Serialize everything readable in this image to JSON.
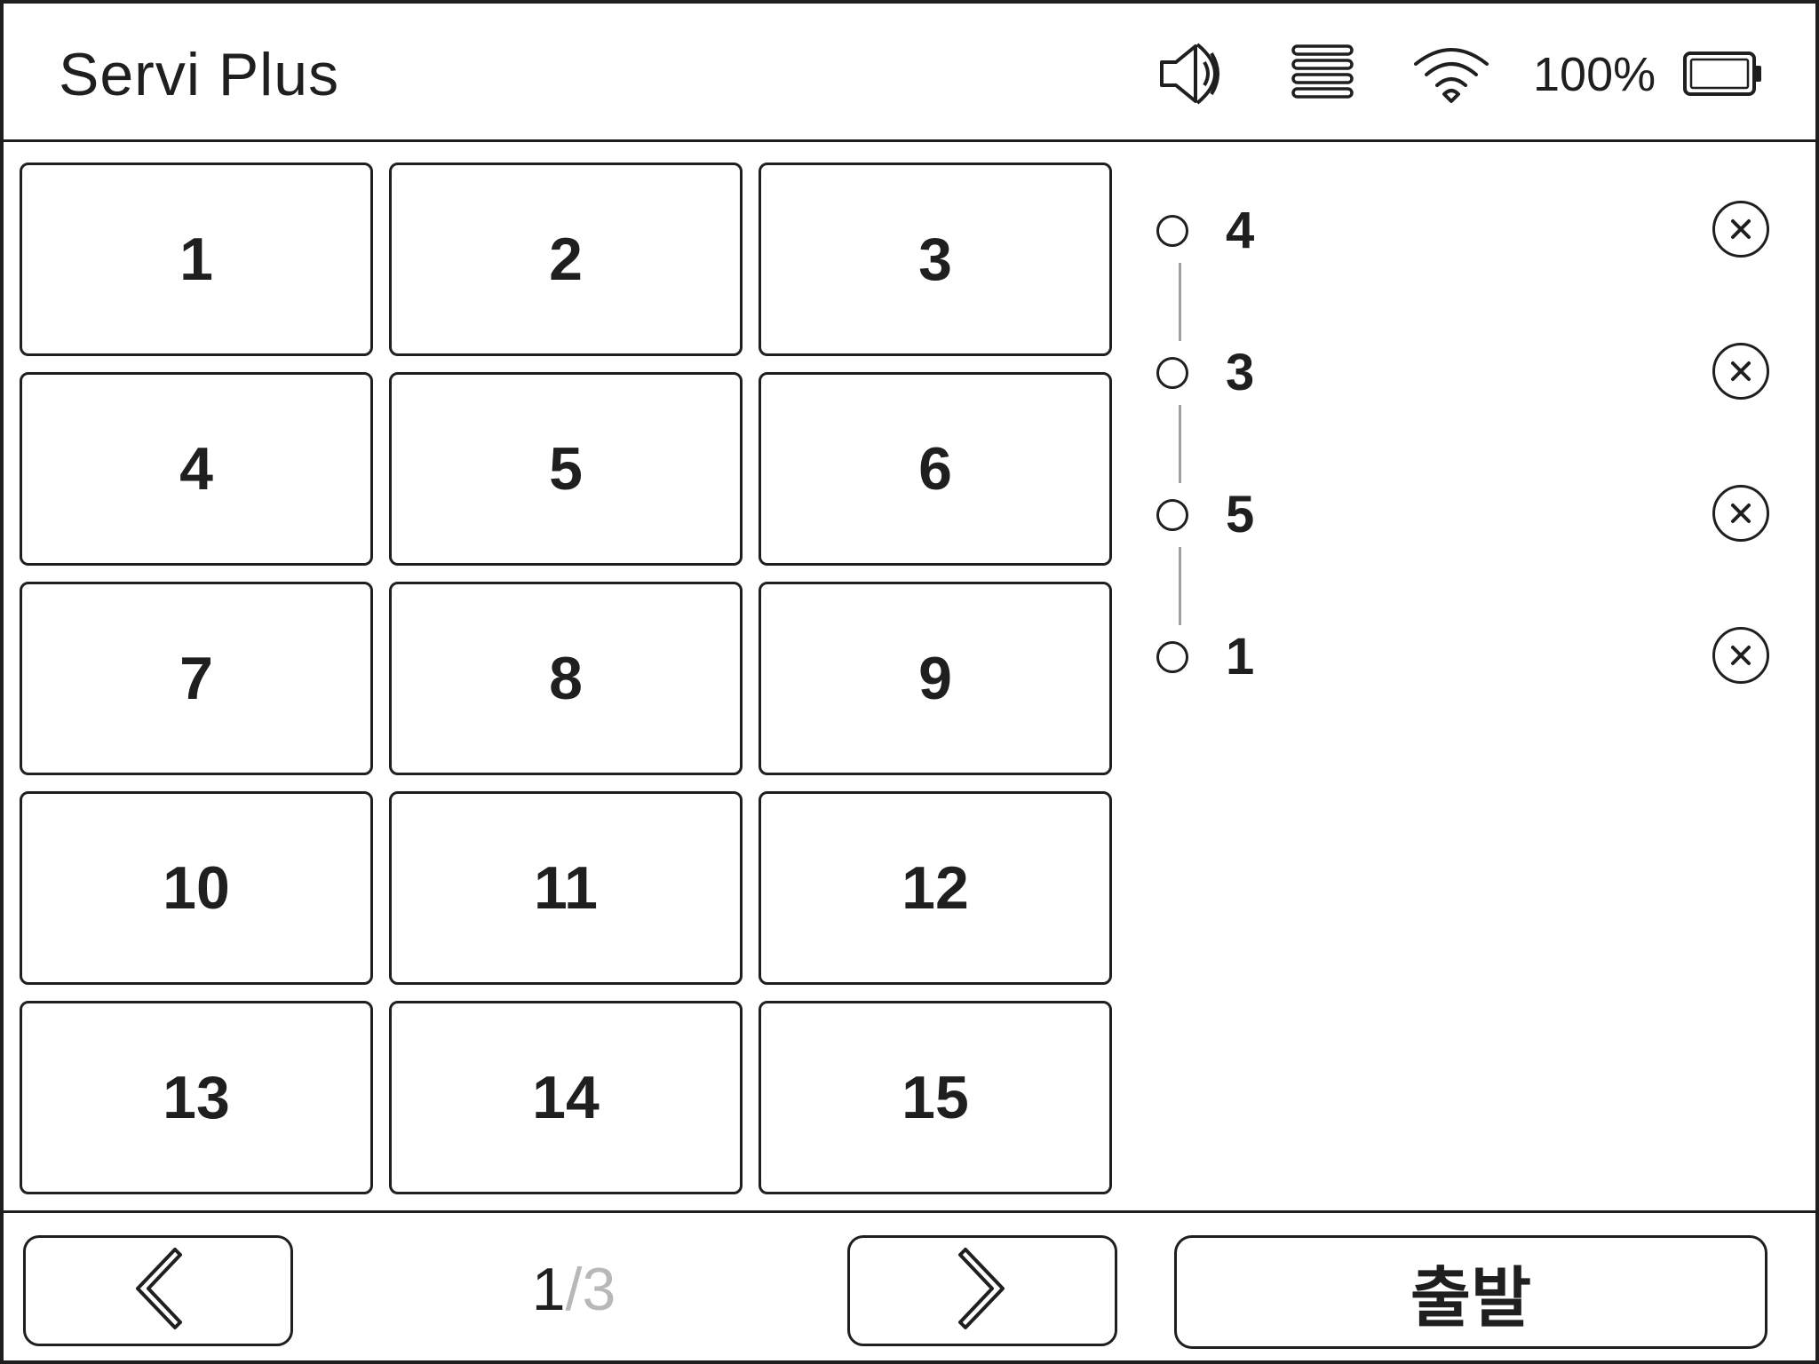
{
  "header": {
    "title": "Servi Plus",
    "icons": [
      "speaker-icon",
      "menu-icon",
      "wifi-icon",
      "battery-icon"
    ],
    "battery_percent": "100%"
  },
  "tables": [
    "1",
    "2",
    "3",
    "4",
    "5",
    "6",
    "7",
    "8",
    "9",
    "10",
    "11",
    "12",
    "13",
    "14",
    "15"
  ],
  "queue": [
    {
      "label": "4"
    },
    {
      "label": "3"
    },
    {
      "label": "5"
    },
    {
      "label": "1"
    }
  ],
  "pagination": {
    "current": "1",
    "separator": "/",
    "total": "3"
  },
  "footer": {
    "depart_label": "출발"
  }
}
